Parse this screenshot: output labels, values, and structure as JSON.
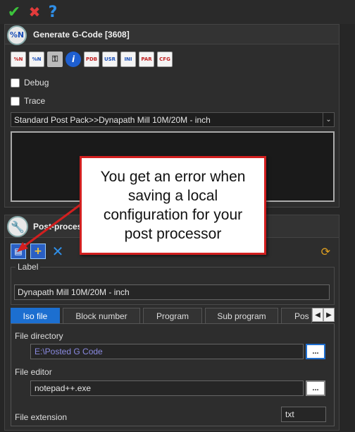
{
  "toolbar": {
    "ok_glyph": "✔",
    "cancel_glyph": "✖",
    "help_glyph": "?"
  },
  "generate_panel": {
    "icon_text": "%N",
    "title": "Generate G-Code  [3608]",
    "icons": [
      "%N",
      "%N",
      "key",
      "i",
      "PDB",
      "USR",
      "INI",
      "PAR",
      "CFG"
    ],
    "debug_label": "Debug",
    "trace_label": "Trace",
    "post_select_value": "Standard Post Pack>>Dynapath Mill 10M/20M - inch",
    "post_select_chevron": "⌄"
  },
  "callout": {
    "text": "You get an error when saving a local configuration for your post processor",
    "border_color": "#d21f1f"
  },
  "postprocessor_panel": {
    "title": "Post-process",
    "toolbar": {
      "save_glyph": "▤",
      "save_add_glyph": "+",
      "delete_glyph": "✕",
      "sync_glyph": "⟳"
    },
    "label_group_title": "Label",
    "label_value": "Dynapath Mill 10M/20M - inch",
    "tabs": [
      "Iso file",
      "Block number",
      "Program",
      "Sub program",
      "Pos"
    ],
    "active_tab": "Iso file",
    "tab_scroll_left": "◀",
    "tab_scroll_right": "▶",
    "fields": {
      "file_directory_label": "File directory",
      "file_directory_value": "E:\\Posted G Code",
      "file_editor_label": "File editor",
      "file_editor_value": "notepad++.exe",
      "file_extension_label": "File extension",
      "file_extension_value": "txt",
      "browse_label": "..."
    }
  },
  "colors": {
    "background": "#262626",
    "accent": "#1c6fd0",
    "callout_border": "#d21f1f"
  }
}
